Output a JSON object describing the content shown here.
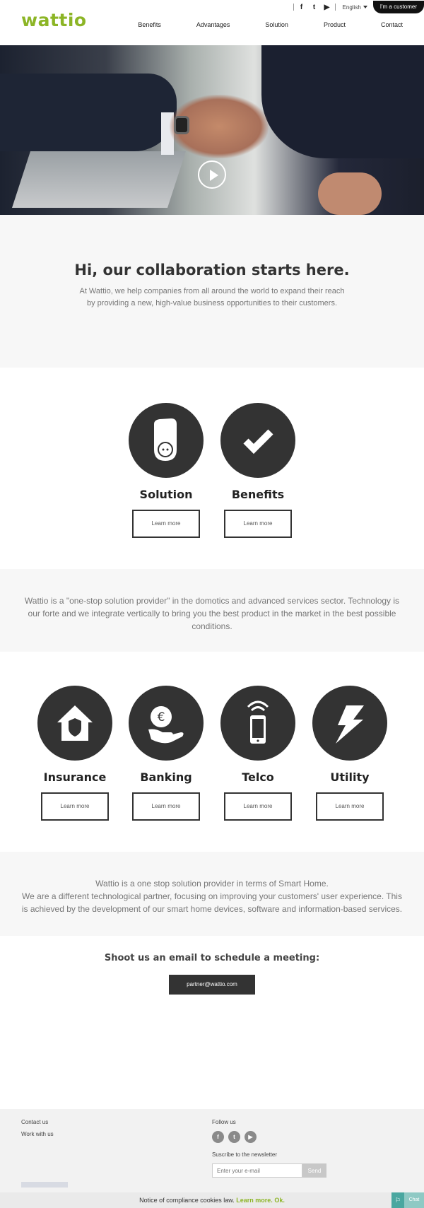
{
  "header": {
    "logo": "wattio",
    "social": [
      "f",
      "t",
      "▶"
    ],
    "language": "English",
    "customer_button": "I'm a customer",
    "nav": [
      "Benefits",
      "Advantages",
      "Solution",
      "Product",
      "Contact"
    ]
  },
  "intro": {
    "title": "Hi, our collaboration starts here.",
    "text": "At Wattio, we help companies from all around the world to expand their reach by providing a new, high-value business opportunities to their customers."
  },
  "features_top": [
    {
      "label": "Solution",
      "button": "Learn more",
      "icon": "plug-device-icon"
    },
    {
      "label": "Benefits",
      "button": "Learn more",
      "icon": "checkmark-icon"
    }
  ],
  "provider_text": "Wattio is a \"one-stop solution provider\" in the domotics and advanced services sector. Technology is our forte and we integrate vertically to bring you the best product in the market in the best possible conditions.",
  "features_sectors": [
    {
      "label": "Insurance",
      "button": "Learn more",
      "icon": "house-shield-icon"
    },
    {
      "label": "Banking",
      "button": "Learn more",
      "icon": "euro-hand-icon"
    },
    {
      "label": "Telco",
      "button": "Learn more",
      "icon": "phone-signal-icon"
    },
    {
      "label": "Utility",
      "button": "Learn more",
      "icon": "lightning-icon"
    }
  ],
  "smart_home": {
    "line1": "Wattio is a one stop solution provider in terms of Smart Home.",
    "line2": "We are a different technological partner, focusing on improving your customers' user experience. This is achieved by the development of our smart home devices, software and information-based services."
  },
  "email": {
    "heading": "Shoot us an email to schedule a meeting:",
    "button": "partner@wattio.com"
  },
  "footer": {
    "contact": "Contact us",
    "work": "Work with us",
    "follow": "Follow us",
    "social": [
      "f",
      "t",
      "▶"
    ],
    "newsletter_label": "Suscribe to the newsletter",
    "newsletter_placeholder": "Enter your e-mail",
    "send": "Send"
  },
  "cookie": {
    "text": "Notice of compliance cookies law.",
    "link": "Learn more.",
    "ok": "Ok."
  },
  "chat": {
    "label": "Chat"
  },
  "colors": {
    "brand": "#8cb526",
    "dark": "#333333",
    "light_bg": "#f7f7f7"
  }
}
